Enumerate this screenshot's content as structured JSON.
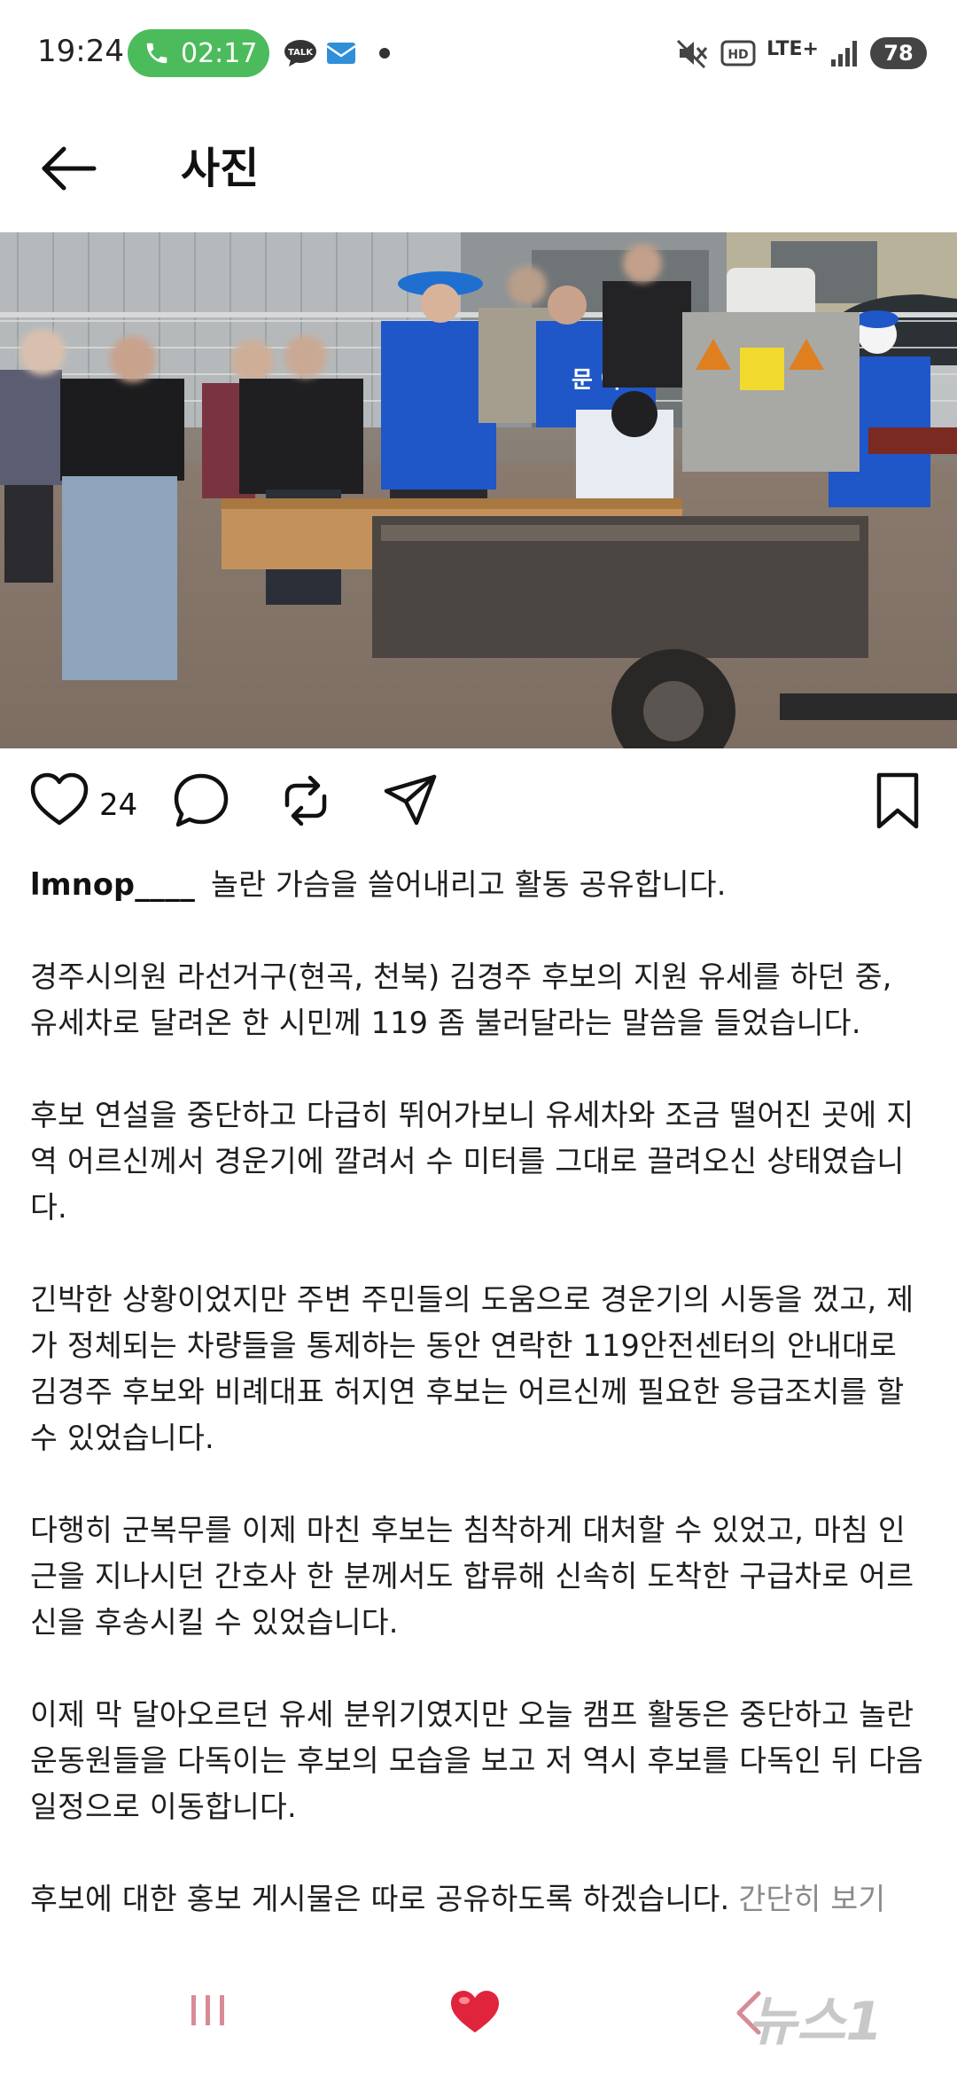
{
  "status_bar": {
    "time": "19:24",
    "call_timer": "02:17",
    "network": "LTE+",
    "battery": "78",
    "icons": [
      "phone-icon",
      "talk-icon",
      "mail-icon",
      "mute-icon",
      "hd-icon",
      "signal-icon"
    ]
  },
  "header": {
    "title": "사진",
    "back_icon": "arrow-left-icon"
  },
  "post": {
    "like_count": "24",
    "username": "lmnop____",
    "headline": "놀란 가슴을 쓸어내리고 활동 공유합니다.",
    "paragraphs": [
      "경주시의원 라선거구(현곡, 천북) 김경주 후보의 지원 유세를 하던 중, 유세차로 달려온 한 시민께 119 좀 불러달라는 말씀을 들었습니다.",
      "후보 연설을 중단하고 다급히 뛰어가보니 유세차와 조금 떨어진 곳에 지역 어르신께서 경운기에 깔려서 수 미터를 그대로 끌려오신 상태였습니다.",
      "긴박한 상황이었지만 주변 주민들의 도움으로 경운기의 시동을 껐고, 제가 정체되는 차량들을 통제하는 동안 연락한 119안전센터의 안내대로 김경주 후보와 비례대표 허지연 후보는 어르신께 필요한 응급조치를 할 수 있었습니다.",
      "다행히 군복무를 이제 마친 후보는 침착하게 대처할 수 있었고, 마침 인근을 지나시던 간호사 한 분께서도 합류해 신속히 도착한 구급차로 어르신을 후송시킬 수 있었습니다.",
      "이제 막 달아오르던 유세 분위기였지만 오늘 캠프 활동은 중단하고 놀란 운동원들을 다독이는 후보의 모습을 보고 저 역시 후보를 다독인 뒤 다음 일정으로 이동합니다."
    ],
    "last_line": "후보에 대한 홍보 게시물은 따로 공유하도록 하겠습니다.",
    "more_link": "간단히 보기"
  },
  "photo": {
    "subject": "photo-of-people-around-cultivator",
    "vest_text": "문 아"
  },
  "nav": {
    "icons": [
      "recent-apps-icon",
      "home-heart-icon",
      "back-chevron-icon"
    ],
    "watermark": "뉴스1"
  },
  "colors": {
    "call_green": "#4cbb5c",
    "heart_red": "#e0243b",
    "muted_text": "#8a8a8a",
    "campaign_blue": "#1f56c8"
  }
}
